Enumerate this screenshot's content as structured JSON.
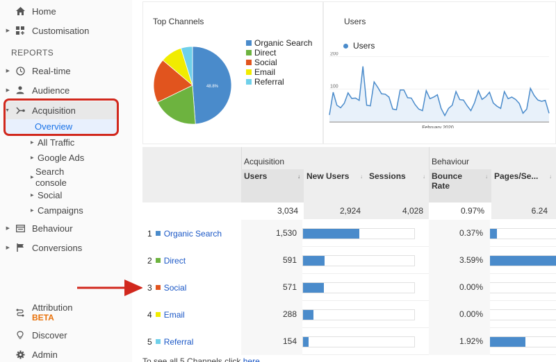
{
  "sidebar": {
    "top_items": [
      {
        "label": "Home",
        "icon": "home-icon"
      },
      {
        "label": "Customisation",
        "icon": "dashboard-icon"
      }
    ],
    "section_label": "REPORTS",
    "report_items": [
      {
        "label": "Real-time",
        "icon": "clock-icon"
      },
      {
        "label": "Audience",
        "icon": "person-icon"
      },
      {
        "label": "Acquisition",
        "icon": "acquisition-icon"
      }
    ],
    "acquisition_sub": {
      "overview": "Overview",
      "items": [
        "All Traffic",
        "Google Ads",
        "Search console",
        "Social",
        "Campaigns"
      ]
    },
    "more_items": [
      {
        "label": "Behaviour",
        "icon": "behaviour-icon"
      },
      {
        "label": "Conversions",
        "icon": "flag-icon"
      }
    ],
    "bottom_items": [
      {
        "label": "Attribution",
        "badge": "BETA",
        "icon": "attribution-icon"
      },
      {
        "label": "Discover",
        "icon": "lightbulb-icon"
      },
      {
        "label": "Admin",
        "icon": "gear-icon"
      }
    ]
  },
  "top_channels": {
    "title": "Top Channels",
    "slice_label": "48.8%"
  },
  "users_chart": {
    "title": "Users",
    "legend": "Users"
  },
  "table": {
    "groups": [
      "Acquisition",
      "Behaviour"
    ],
    "columns": [
      "Users",
      "New Users",
      "Sessions",
      "Bounce Rate",
      "Pages/Se..."
    ],
    "totals": [
      "3,034",
      "2,924",
      "4,028",
      "0.97%",
      "6.24"
    ],
    "rows": [
      {
        "rank": "1",
        "channel": "Organic Search",
        "users": "1,530",
        "users_share": 0.504,
        "bounce": "0.37%",
        "bounce_value": 0.37
      },
      {
        "rank": "2",
        "channel": "Direct",
        "users": "591",
        "users_share": 0.195,
        "bounce": "3.59%",
        "bounce_value": 3.59
      },
      {
        "rank": "3",
        "channel": "Social",
        "users": "571",
        "users_share": 0.188,
        "bounce": "0.00%",
        "bounce_value": 0
      },
      {
        "rank": "4",
        "channel": "Email",
        "users": "288",
        "users_share": 0.095,
        "bounce": "0.00%",
        "bounce_value": 0
      },
      {
        "rank": "5",
        "channel": "Referral",
        "users": "154",
        "users_share": 0.051,
        "bounce": "1.92%",
        "bounce_value": 1.92
      }
    ],
    "footer_text": "To see all 5 Channels click ",
    "footer_link": "here"
  },
  "colors": {
    "organic": "#4a8bcb",
    "direct": "#6db33f",
    "social": "#e1541e",
    "email": "#f1ec00",
    "referral": "#6fd0ea",
    "accent_red": "#d1281d",
    "link": "#1a57c6"
  },
  "chart_data": [
    {
      "type": "pie",
      "title": "Top Channels",
      "categories": [
        "Organic Search",
        "Direct",
        "Social",
        "Email",
        "Referral"
      ],
      "values": [
        48.8,
        19.0,
        18.4,
        9.0,
        4.8
      ],
      "legend": "right"
    },
    {
      "type": "area",
      "title": "Users",
      "xlabel": "February 2020",
      "ylabel": "",
      "yticks": [
        100,
        200
      ],
      "ylim": [
        0,
        210
      ],
      "legend": "top-left",
      "series": [
        {
          "name": "Users",
          "values": [
            20,
            90,
            50,
            42,
            56,
            88,
            71,
            72,
            65,
            170,
            50,
            48,
            122,
            105,
            85,
            84,
            75,
            38,
            36,
            97,
            97,
            73,
            72,
            52,
            38,
            33,
            95,
            70,
            75,
            82,
            40,
            18,
            40,
            50,
            92,
            67,
            66,
            48,
            33,
            58,
            95,
            68,
            76,
            90,
            57,
            47,
            40,
            92,
            70,
            75,
            68,
            55,
            25,
            38,
            102,
            80,
            66,
            62,
            65,
            25
          ]
        }
      ]
    }
  ]
}
